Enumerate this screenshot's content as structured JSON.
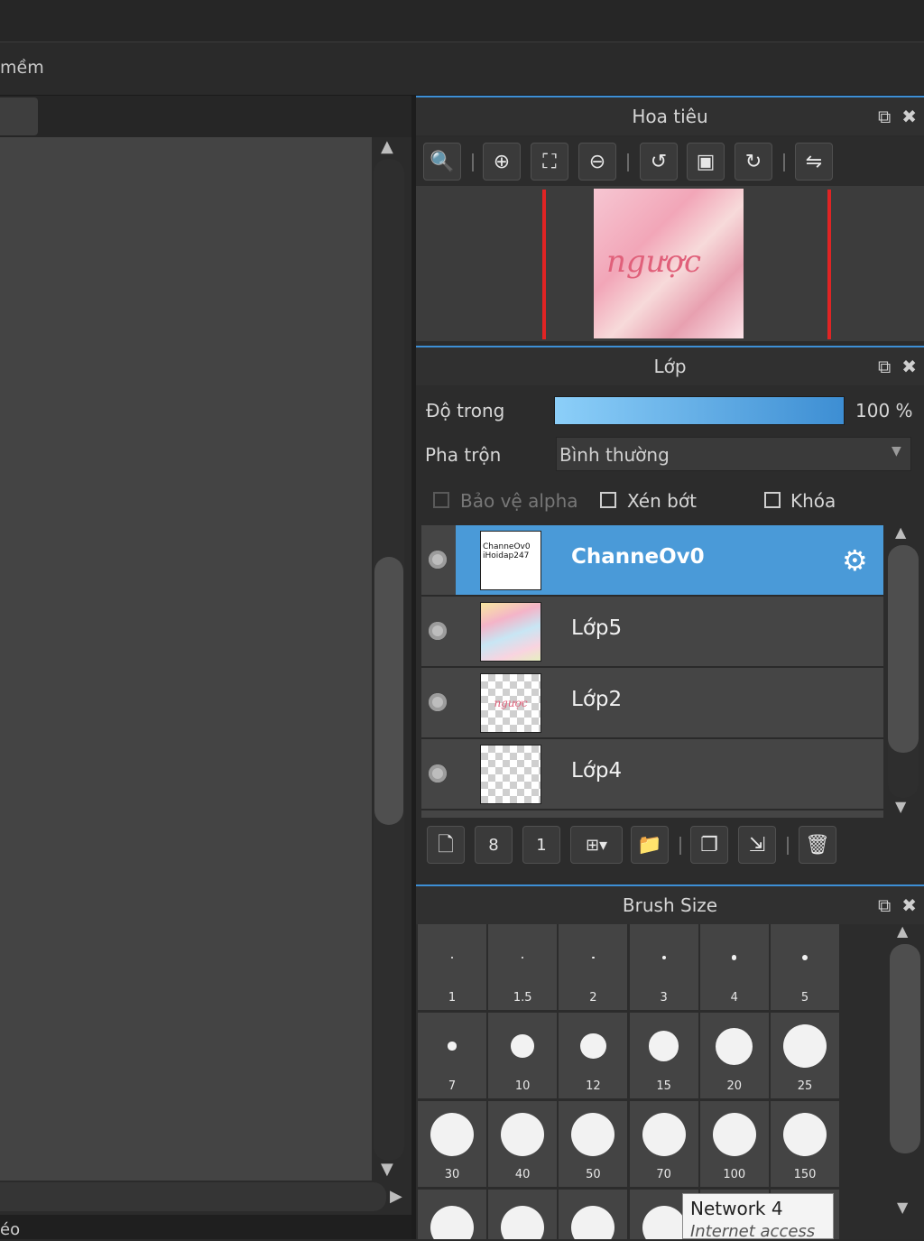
{
  "toolbar2": {
    "partial_text": "mềm"
  },
  "statusbar": {
    "partial_text": "éo"
  },
  "navigator": {
    "title": "Hoa tiêu",
    "tools": [
      {
        "icon": "zoom-actual-icon",
        "glyph": "🔍"
      },
      {
        "icon": "zoom-in-icon",
        "glyph": "⊕"
      },
      {
        "icon": "fit-screen-icon",
        "glyph": "⛶"
      },
      {
        "icon": "zoom-out-icon",
        "glyph": "⊖"
      },
      {
        "icon": "rotate-left-icon",
        "glyph": "↺"
      },
      {
        "icon": "reset-view-icon",
        "glyph": "▣"
      },
      {
        "icon": "rotate-right-icon",
        "glyph": "↻"
      },
      {
        "icon": "flip-horizontal-icon",
        "glyph": "⇋"
      }
    ],
    "thumbnail_text": "ngược"
  },
  "layers": {
    "title": "Lớp",
    "opacity_label": "Độ trong",
    "opacity_value": "100 %",
    "opacity_fraction": 1.0,
    "blend_label": "Pha trộn",
    "blend_value": "Bình thường",
    "protect_alpha_label": "Bảo vệ alpha",
    "clipping_label": "Xén bớt",
    "lock_label": "Khóa",
    "items": [
      {
        "name": "ChanneOv0",
        "thumb_text": "ChanneOv0 iHoidap247",
        "selected": true
      },
      {
        "name": "Lớp5",
        "selected": false
      },
      {
        "name": "Lớp2",
        "thumb_text": "ngược",
        "selected": false
      },
      {
        "name": "Lớp4",
        "selected": false
      }
    ],
    "tools": [
      {
        "icon": "new-layer-icon",
        "glyph": "🗋"
      },
      {
        "icon": "new-8bit-layer-icon",
        "glyph": "8"
      },
      {
        "icon": "new-1bit-layer-icon",
        "glyph": "1"
      },
      {
        "icon": "add-special-layer-icon",
        "glyph": "⊞▾"
      },
      {
        "icon": "new-folder-icon",
        "glyph": "📁"
      },
      {
        "icon": "duplicate-layer-icon",
        "glyph": "❐"
      },
      {
        "icon": "merge-down-icon",
        "glyph": "⇲"
      },
      {
        "icon": "delete-layer-icon",
        "glyph": "🗑"
      }
    ]
  },
  "brush_size": {
    "title": "Brush Size",
    "sizes": [
      "1",
      "1.5",
      "2",
      "3",
      "4",
      "5",
      "7",
      "10",
      "12",
      "15",
      "20",
      "25",
      "30",
      "40",
      "50",
      "70",
      "100",
      "150"
    ]
  },
  "tooltip": {
    "title": "Network  4",
    "subtitle": "Internet access"
  },
  "icons": {
    "popout": "popout-icon",
    "close": "close-icon",
    "gear": "gear-icon"
  },
  "colors": {
    "accent": "#3d8fd6",
    "selected_row": "#4a9ad8",
    "nav_frame": "#e02424"
  }
}
